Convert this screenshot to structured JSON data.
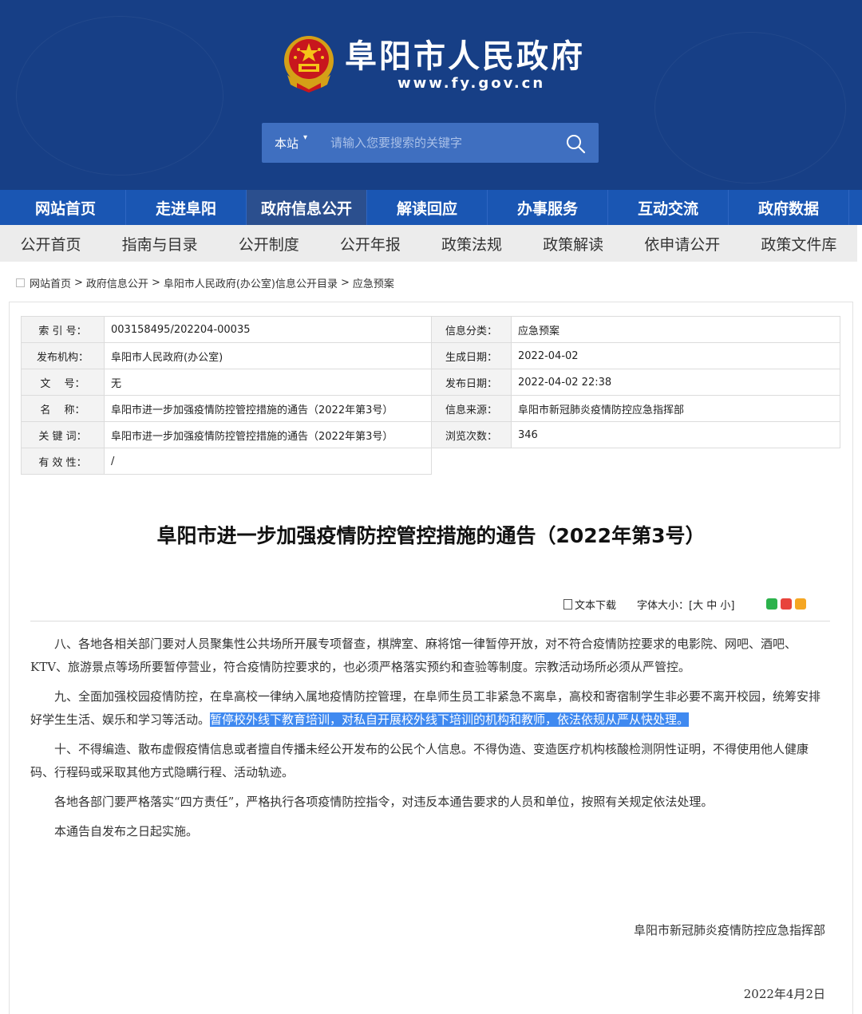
{
  "header": {
    "title": "阜阳市人民政府",
    "url": "www.fy.gov.cn",
    "search": {
      "scope": "本站",
      "placeholder": "请输入您要搜索的关键字"
    }
  },
  "main_nav": [
    "网站首页",
    "走进阜阳",
    "政府信息公开",
    "解读回应",
    "办事服务",
    "互动交流",
    "政府数据"
  ],
  "main_nav_active": "政府信息公开",
  "sub_nav": [
    "公开首页",
    "指南与目录",
    "公开制度",
    "公开年报",
    "政策法规",
    "政策解读",
    "依申请公开",
    "政策文件库"
  ],
  "breadcrumb": [
    "网站首页",
    "政府信息公开",
    "阜阳市人民政府(办公室)信息公开目录",
    "应急预案"
  ],
  "meta": {
    "index_label": "索 引 号：",
    "index": "003158495/202204-00035",
    "category_label": "信息分类：",
    "category": "应急预案",
    "publisher_label": "发布机构：",
    "publisher": "阜阳市人民政府(办公室)",
    "created_label": "生成日期：",
    "created": "2022-04-02",
    "docno_label": "文　 号：",
    "docno": "无",
    "published_label": "发布日期：",
    "published": "2022-04-02 22:38",
    "name_label": "名　 称：",
    "name": "阜阳市进一步加强疫情防控管控措施的通告（2022年第3号）",
    "source_label": "信息来源：",
    "source": "阜阳市新冠肺炎疫情防控应急指挥部",
    "keywords_label": "关 键 词：",
    "keywords": "阜阳市进一步加强疫情防控管控措施的通告（2022年第3号）",
    "views_label": "浏览次数：",
    "views": "346",
    "validity_label": "有 效 性：",
    "validity": "/"
  },
  "doc": {
    "title": "阜阳市进一步加强疫情防控管控措施的通告（2022年第3号）",
    "download": "文本下载",
    "font_size_label": "字体大小：",
    "font_size_options": "[大 中 小]",
    "p8": "八、各地各相关部门要对人员聚集性公共场所开展专项督查，棋牌室、麻将馆一律暂停开放，对不符合疫情防控要求的电影院、网吧、酒吧、KTV、旅游景点等场所要暂停营业，符合疫情防控要求的，也必须严格落实预约和查验等制度。宗教活动场所必须从严管控。",
    "p9_a": "九、全面加强校园疫情防控，在阜高校一律纳入属地疫情防控管理，在阜师生员工非紧急不离阜，高校和寄宿制学生非必要不离开校园，统筹安排好学生生活、娱乐和学习等活动。",
    "p9_b": "暂停校外线下教育培训，对私自开展校外线下培训的机构和教师，依法依规从严从快处理。",
    "p10": "十、不得编造、散布虚假疫情信息或者擅自传播未经公开发布的公民个人信息。不得伪造、变造医疗机构核酸检测阴性证明，不得使用他人健康码、行程码或采取其他方式隐瞒行程、活动轨迹。",
    "p11": "各地各部门要严格落实“四方责任”，严格执行各项疫情防控指令，对违反本通告要求的人员和单位，按照有关规定依法处理。",
    "p12": "本通告自发布之日起实施。",
    "signature": "阜阳市新冠肺炎疫情防控应急指挥部",
    "date": "2022年4月2日"
  },
  "colors": {
    "header_bg": "#173f86",
    "nav_bg": "#1a56b3",
    "nav_active": "#2b4f8e",
    "highlight": "#3f89f0"
  }
}
